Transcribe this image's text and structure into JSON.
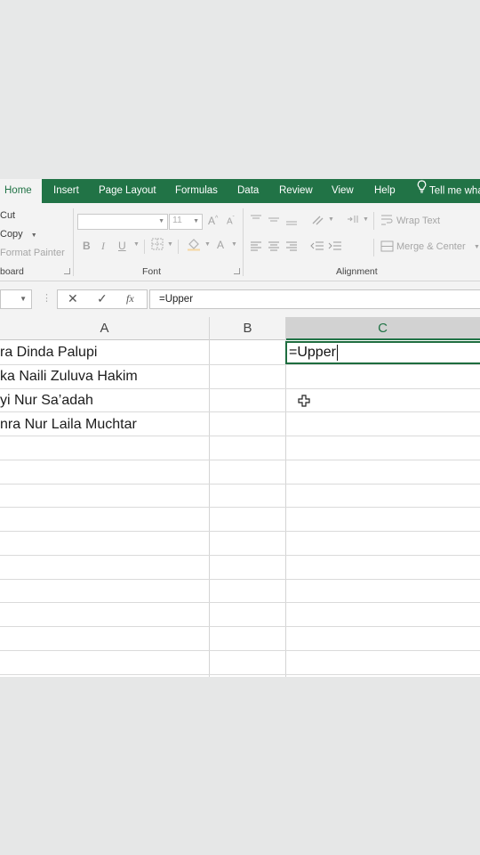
{
  "tabs": [
    {
      "label": "Home",
      "active": true
    },
    {
      "label": "Insert"
    },
    {
      "label": "Page Layout"
    },
    {
      "label": "Formulas"
    },
    {
      "label": "Data"
    },
    {
      "label": "Review"
    },
    {
      "label": "View"
    },
    {
      "label": "Help"
    },
    {
      "label": "Tell me wha",
      "icon": "lightbulb-icon"
    }
  ],
  "clipboard": {
    "cut": "Cut",
    "copy": "Copy",
    "format_painter": "Format Painter",
    "group_label": "board"
  },
  "font": {
    "font_size": "11",
    "bold": "B",
    "italic": "I",
    "underline": "U",
    "grow": "A",
    "shrink": "A",
    "color": "A",
    "group_label": "Font"
  },
  "alignment": {
    "wrap_text": "Wrap Text",
    "merge_center": "Merge & Center",
    "group_label": "Alignment"
  },
  "formula_bar": {
    "cancel": "✕",
    "enter": "✓",
    "fx": "fx",
    "value": "=Upper"
  },
  "columns": [
    "A",
    "B",
    "C"
  ],
  "rows": [
    {
      "a": "ra Dinda Palupi"
    },
    {
      "a": "ka Naili Zuluva Hakim"
    },
    {
      "a": "yi Nur Sa’adah"
    },
    {
      "a": "nra Nur Laila Muchtar"
    }
  ],
  "active_cell": {
    "column": "C",
    "value": "=Upper"
  },
  "colors": {
    "accent": "#217346",
    "ribbon_bg": "#f3f3f3"
  }
}
